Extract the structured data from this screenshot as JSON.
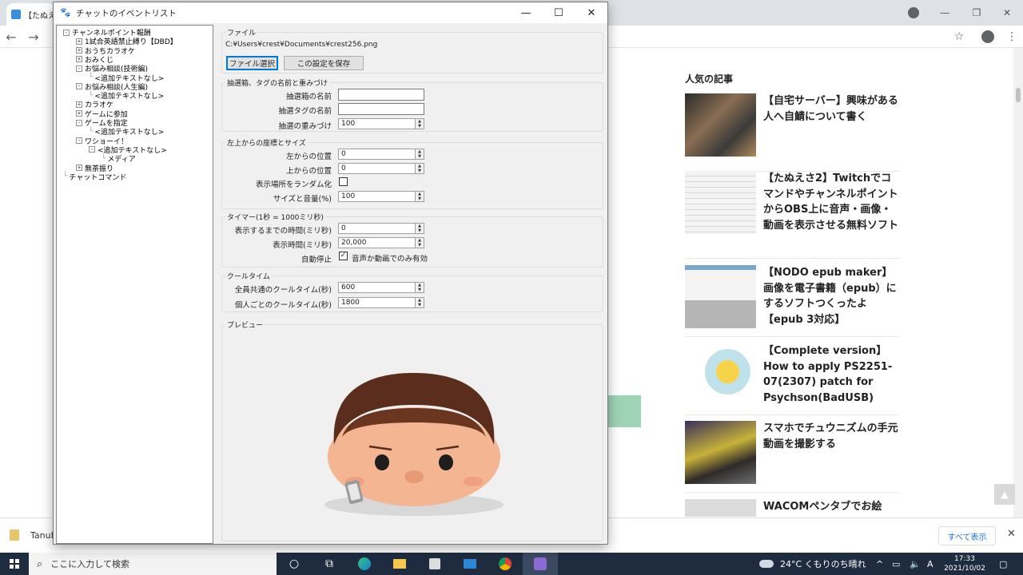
{
  "browser": {
    "tab_title": "【たぬえ",
    "nav": {
      "back": "←",
      "forward": "→"
    },
    "window_controls": {
      "minimize": "—",
      "restore": "❐",
      "close": "✕"
    },
    "toolbar_icons": {
      "bookmark": "☆",
      "menu": "⋮"
    }
  },
  "sidebar": {
    "heading": "人気の記事",
    "articles": [
      {
        "title": "【自宅サーバー】興味がある人へ自鯖について書く",
        "thumb_color": "#6b5a4e"
      },
      {
        "title": "【たぬえさ2】Twitchでコマンドやチャンネルポイントから​OBS上に音声・画像・動画を表示させる無料ソフト",
        "thumb_color": "#dcdcdc"
      },
      {
        "title": "【NODO epub maker】画像を電子書籍（epub）にするソフトつくったよ【epub 3対応】",
        "thumb_color": "#b8b8b8"
      },
      {
        "title": "【Complete version】How to apply PS2251-07(2307) patch for Psychson(BadUSB)",
        "thumb_color": "#e9f1ef"
      },
      {
        "title": "スマホでチュウニズムの手元動画を撮影する",
        "thumb_color": "#4a3f6b"
      },
      {
        "title": "WACOMペンタブでお絵",
        "thumb_color": "#cfcfcf"
      }
    ]
  },
  "download_bar": {
    "item_name": "TanuE",
    "show_all": "すべて表示",
    "close": "✕"
  },
  "taskbar": {
    "search_placeholder": "ここに入力して検索",
    "weather": "24°C くもりのち晴れ",
    "ime": "A",
    "time": "17:33",
    "date": "2021/10/02"
  },
  "app": {
    "title": "チャットのイベントリスト",
    "window_controls": {
      "minimize": "—",
      "maximize": "☐",
      "close": "✕"
    },
    "tree": [
      {
        "label": "チャンネルポイント報酬",
        "toggle": "⊟",
        "level": 0
      },
      {
        "label": "1試合英語禁止縛り【DBD】",
        "toggle": "⊞",
        "level": 1
      },
      {
        "label": "おうちカラオケ",
        "toggle": "⊞",
        "level": 1
      },
      {
        "label": "おみくじ",
        "toggle": "⊞",
        "level": 1
      },
      {
        "label": "お悩み相談(技術編)",
        "toggle": "⊟",
        "level": 1
      },
      {
        "label": "<追加テキストなし>",
        "toggle": "",
        "level": 2
      },
      {
        "label": "お悩み相談(人生編)",
        "toggle": "⊟",
        "level": 1
      },
      {
        "label": "<追加テキストなし>",
        "toggle": "",
        "level": 2
      },
      {
        "label": "カラオケ",
        "toggle": "⊞",
        "level": 1
      },
      {
        "label": "ゲームに参加",
        "toggle": "⊞",
        "level": 1
      },
      {
        "label": "ゲームを指定",
        "toggle": "⊟",
        "level": 1
      },
      {
        "label": "<追加テキストなし>",
        "toggle": "",
        "level": 2
      },
      {
        "label": "ワショーイ！",
        "toggle": "⊟",
        "level": 1
      },
      {
        "label": "<追加テキストなし>",
        "toggle": "⊟",
        "level": 2
      },
      {
        "label": "メディア",
        "toggle": "",
        "level": 3
      },
      {
        "label": "無茶振り",
        "toggle": "⊞",
        "level": 1
      },
      {
        "label": "チャットコマンド",
        "toggle": "",
        "level": 0
      }
    ],
    "file_group": {
      "title": "ファイル",
      "path": "C:¥Users¥crest¥Documents¥crest256.png",
      "select_button": "ファイル選択",
      "save_button": "この設定を保存"
    },
    "lottery_group": {
      "title": "抽選箱、タグの名前と重みづけ",
      "box_name_label": "抽選箱の名前",
      "box_name_value": "",
      "tag_name_label": "抽選タグの名前",
      "tag_name_value": "",
      "weight_label": "抽選の重みづけ",
      "weight_value": "100"
    },
    "position_group": {
      "title": "左上からの座標とサイズ",
      "left_label": "左からの位置",
      "left_value": "0",
      "top_label": "上からの位置",
      "top_value": "0",
      "random_label": "表示場所をランダム化",
      "random_checked": false,
      "size_label": "サイズと音量(%)",
      "size_value": "100"
    },
    "timer_group": {
      "title": "タイマー(1秒 = 1000ミリ秒)",
      "delay_label": "表示するまでの時間(ミリ秒)",
      "delay_value": "0",
      "duration_label": "表示時間(ミリ秒)",
      "duration_value": "20,000",
      "autostop_label": "自動停止",
      "autostop_checked": true,
      "autostop_note": "音声か動画でのみ有効"
    },
    "cooltime_group": {
      "title": "クールタイム",
      "global_label": "全員共通のクールタイム(秒)",
      "global_value": "600",
      "user_label": "個人ごとのクールタイム(秒)",
      "user_value": "1800"
    },
    "preview_group": {
      "title": "プレビュー"
    }
  }
}
